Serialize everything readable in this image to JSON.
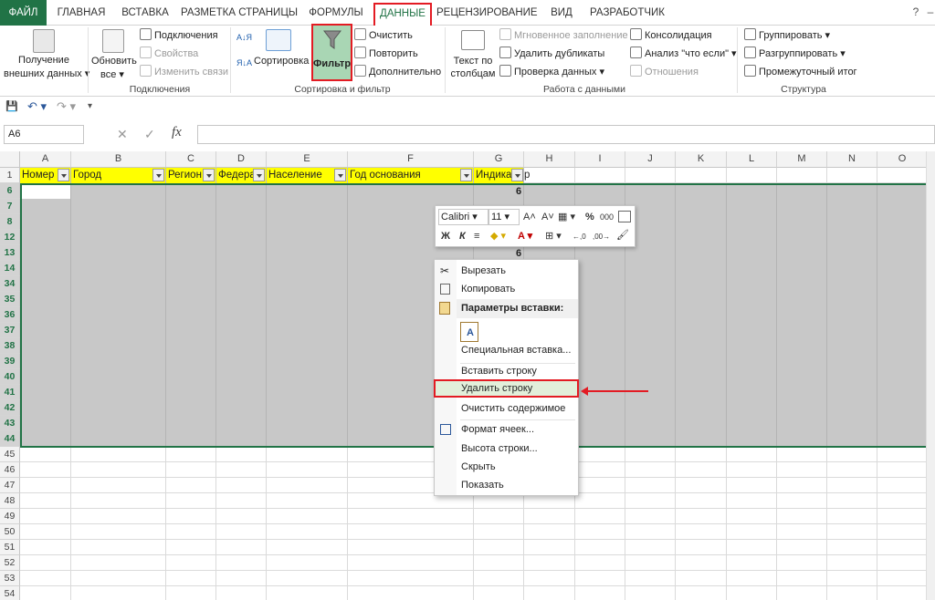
{
  "tabs": [
    "ФАЙЛ",
    "ГЛАВНАЯ",
    "ВСТАВКА",
    "РАЗМЕТКА СТРАНИЦЫ",
    "ФОРМУЛЫ",
    "ДАННЫЕ",
    "РЕЦЕНЗИРОВАНИЕ",
    "ВИД",
    "РАЗРАБОТЧИК"
  ],
  "window": {
    "help": "?",
    "min": "–"
  },
  "ribbon": {
    "external": {
      "line1": "Получение",
      "line2": "внешних данных ▾"
    },
    "refresh": {
      "line1": "Обновить",
      "line2": "все ▾"
    },
    "connections": "Подключения",
    "properties": "Свойства",
    "edit_links": "Изменить связи",
    "group_connections": "Подключения",
    "sort_az": "А↓Я",
    "sort_za": "Я↓А",
    "sort": "Сортировка",
    "filter": "Фильтр",
    "clear": "Очистить",
    "reapply": "Повторить",
    "advanced": "Дополнительно",
    "group_sortfilter": "Сортировка и фильтр",
    "text_to_columns": {
      "line1": "Текст по",
      "line2": "столбцам"
    },
    "flash_fill": "Мгновенное заполнение",
    "remove_dupes": "Удалить дубликаты",
    "validation": "Проверка данных ▾",
    "consolidate": "Консолидация",
    "whatif": "Анализ \"что если\" ▾",
    "relationships": "Отношения",
    "group_datatools": "Работа с данными",
    "group": "Группировать ▾",
    "ungroup": "Разгруппировать ▾",
    "subtotal": "Промежуточный итог",
    "group_outline": "Структура"
  },
  "qat": {
    "save": "💾",
    "undo": "↶ ▾",
    "redo": "↷ ▾",
    "more": "▾"
  },
  "formula_bar": {
    "name_box": "A6",
    "cancel": "✕",
    "enter": "✓",
    "fx": "fx",
    "formula": ""
  },
  "columns": [
    "A",
    "B",
    "C",
    "D",
    "E",
    "F",
    "G",
    "H",
    "I",
    "J",
    "K",
    "L",
    "M",
    "N",
    "O"
  ],
  "rows": [
    "1",
    "6",
    "7",
    "8",
    "12",
    "13",
    "14",
    "34",
    "35",
    "36",
    "37",
    "38",
    "39",
    "40",
    "41",
    "42",
    "43",
    "44",
    "45",
    "46",
    "47",
    "48",
    "49",
    "50",
    "51",
    "52",
    "53",
    "54"
  ],
  "header_cells": [
    "Номер",
    "Город",
    "Регион",
    "Федера",
    "Население",
    "Год основания",
    "Индика",
    "р"
  ],
  "cell_values": {
    "g6": "6",
    "g13": "6"
  },
  "mini_toolbar": {
    "font": "Calibri ▾",
    "size": "11 ▾",
    "grow": "A˄",
    "shrink": "A˅",
    "format": "▦ ▾",
    "percent": "%",
    "thousands": "000",
    "bold": "Ж",
    "italic": "К",
    "align": "≡",
    "fill": "◆ ▾",
    "font_color": "A ▾",
    "borders": "⊞ ▾",
    "inc_dec": "←,0",
    "dec_dec": ",00→",
    "painter": "🖌"
  },
  "context_menu": {
    "cut": "Вырезать",
    "copy": "Копировать",
    "paste_header": "Параметры вставки:",
    "paste_special": "Специальная вставка...",
    "insert_row": "Вставить строку",
    "delete_row": "Удалить строку",
    "clear_contents": "Очистить содержимое",
    "format_cells": "Формат ячеек...",
    "row_height": "Высота строки...",
    "hide": "Скрыть",
    "show": "Показать"
  },
  "colors": {
    "excel_green": "#217346",
    "highlight_red": "#e31b23",
    "header_yellow": "#ffff00",
    "selection_gray": "#c8c8c8"
  }
}
